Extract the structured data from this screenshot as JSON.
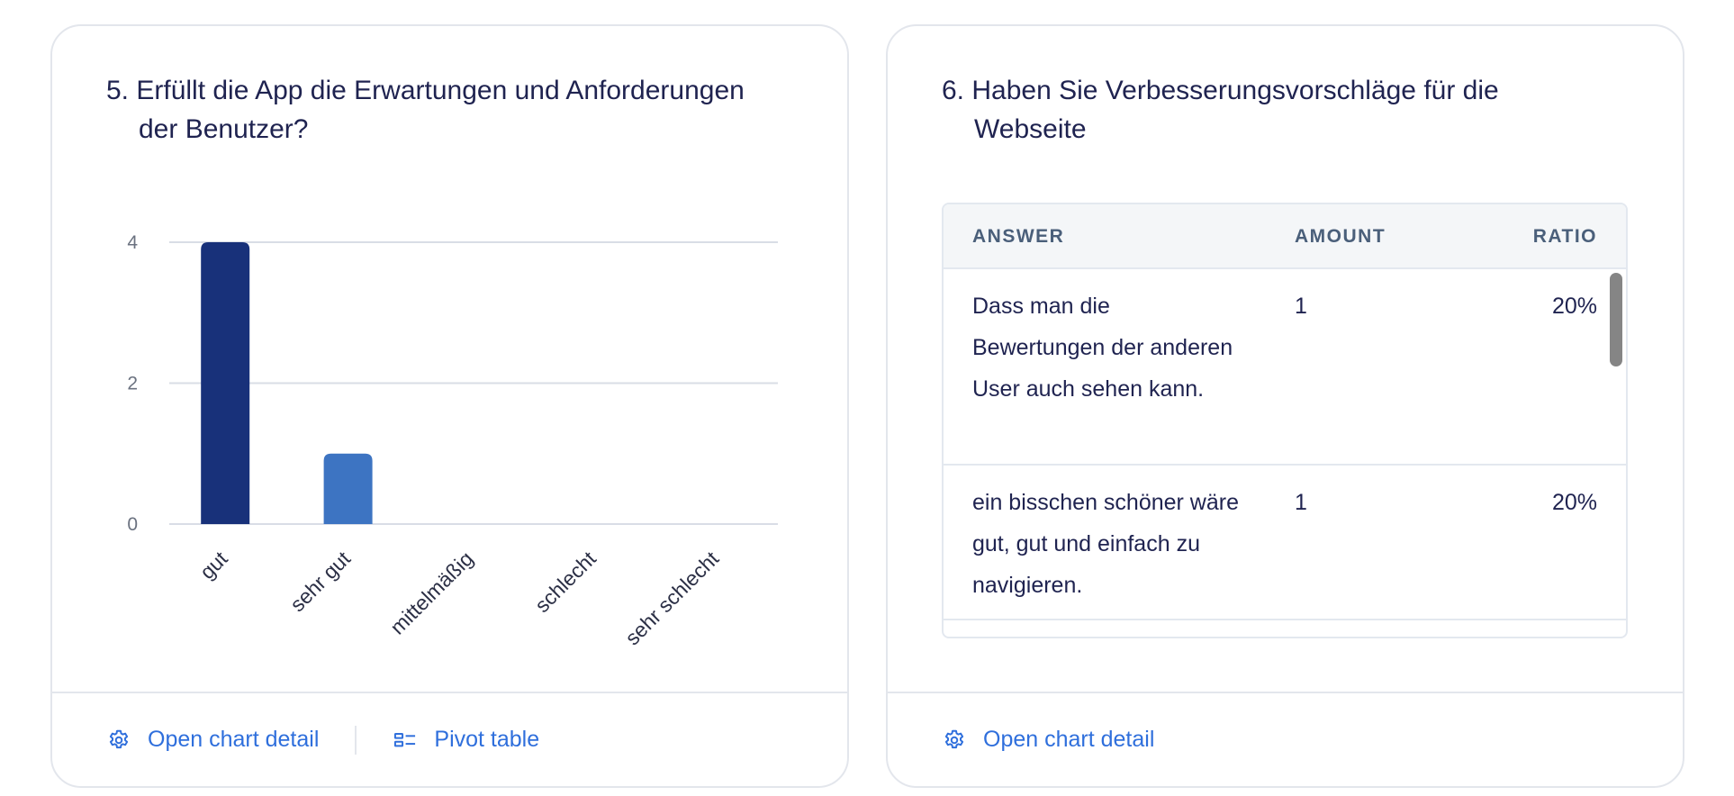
{
  "cards": {
    "left": {
      "title": "5. Erfüllt die App die Erwartungen und Anforderungen der Benutzer?",
      "footer": {
        "open_chart_detail": "Open chart detail",
        "pivot_table": "Pivot table"
      }
    },
    "right": {
      "title": "6. Haben Sie Verbesserungsvorschläge für die Webseite",
      "table": {
        "headers": {
          "answer": "ANSWER",
          "amount": "AMOUNT",
          "ratio": "RATIO"
        },
        "rows": [
          {
            "answer": "Dass man die Bewertungen der anderen User auch sehen kann.",
            "amount": "1",
            "ratio": "20%"
          },
          {
            "answer": "ein bisschen schöner wäre gut, gut und einfach zu navigieren.",
            "amount": "1",
            "ratio": "20%"
          }
        ]
      },
      "footer": {
        "open_chart_detail": "Open chart detail"
      }
    }
  },
  "icons": {
    "gear": "gear-icon",
    "pivot": "pivot-table-icon"
  },
  "colors": {
    "link": "#2f6fdc",
    "bar_primary": "#18317a",
    "bar_secondary": "#3d74c2",
    "grid": "#d9dde6"
  },
  "chart_data": {
    "type": "bar",
    "categories": [
      "gut",
      "sehr gut",
      "mittelmäßig",
      "schlecht",
      "sehr schlecht"
    ],
    "values": [
      4,
      1,
      0,
      0,
      0
    ],
    "bar_colors": [
      "#18317a",
      "#3d74c2",
      "#3d74c2",
      "#3d74c2",
      "#3d74c2"
    ],
    "yticks": [
      0,
      2,
      4
    ],
    "ylim": [
      0,
      4
    ],
    "grid": true,
    "legend": "none"
  }
}
